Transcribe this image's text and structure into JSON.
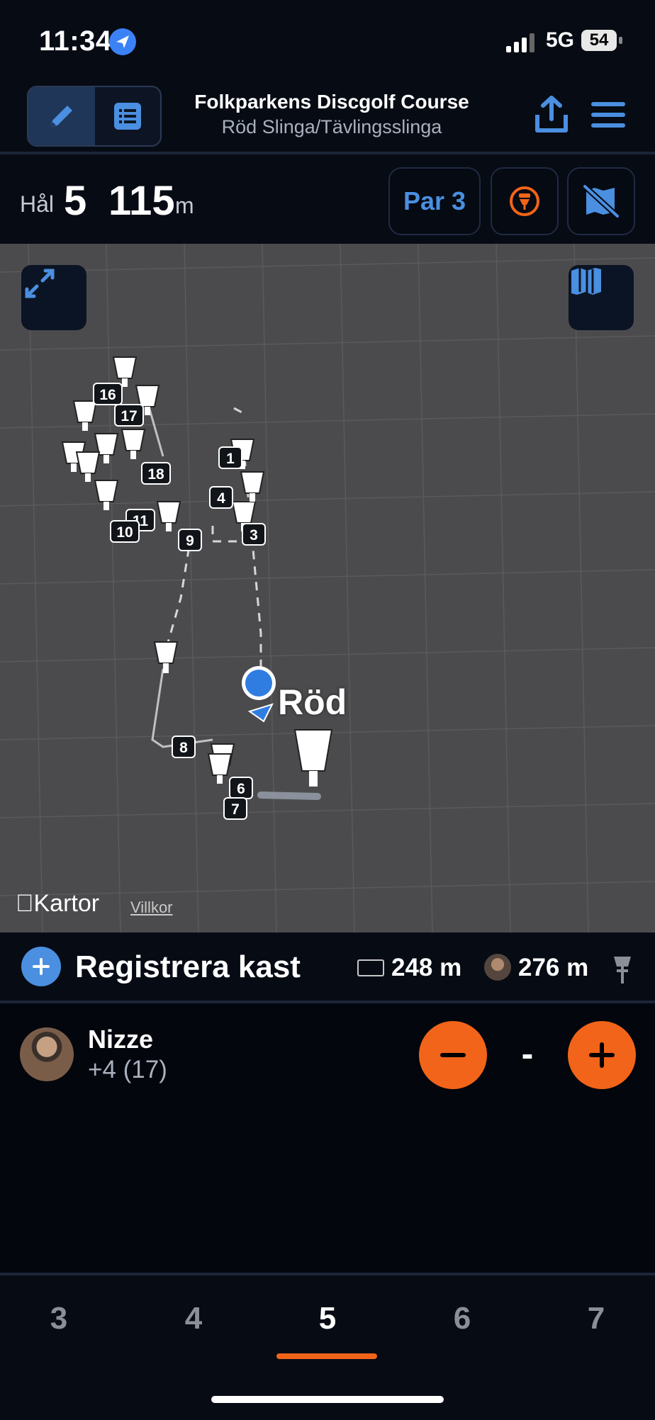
{
  "status": {
    "time": "11:34",
    "network": "5G",
    "battery": "54"
  },
  "header": {
    "title": "Folkparkens Discgolf Course",
    "subtitle": "Röd Slinga/Tävlingsslinga",
    "edit_icon": "pencil-icon",
    "list_icon": "list-icon",
    "share_icon": "share-icon",
    "menu_icon": "hamburger-menu-icon"
  },
  "hole": {
    "label": "Hål",
    "number": "5",
    "length": "115",
    "unit": "m",
    "par": "Par 3"
  },
  "map": {
    "attribution": "Kartor",
    "terms": "Villkor",
    "tee_label": "Röd",
    "hole_markers": [
      "16",
      "17",
      "18",
      "1",
      "4",
      "11",
      "10",
      "9",
      "3",
      "8",
      "6",
      "7"
    ]
  },
  "register": {
    "label": "Registrera kast",
    "distance_1": "248 m",
    "distance_2": "276 m"
  },
  "player": {
    "name": "Nizze",
    "score": "+4 (17)",
    "strokes": "-"
  },
  "tabs": {
    "items": [
      "3",
      "4",
      "5",
      "6",
      "7"
    ],
    "active": "5"
  },
  "colors": {
    "accent_blue": "#4a8fe0",
    "accent_orange": "#f26419",
    "background": "#03060c"
  }
}
